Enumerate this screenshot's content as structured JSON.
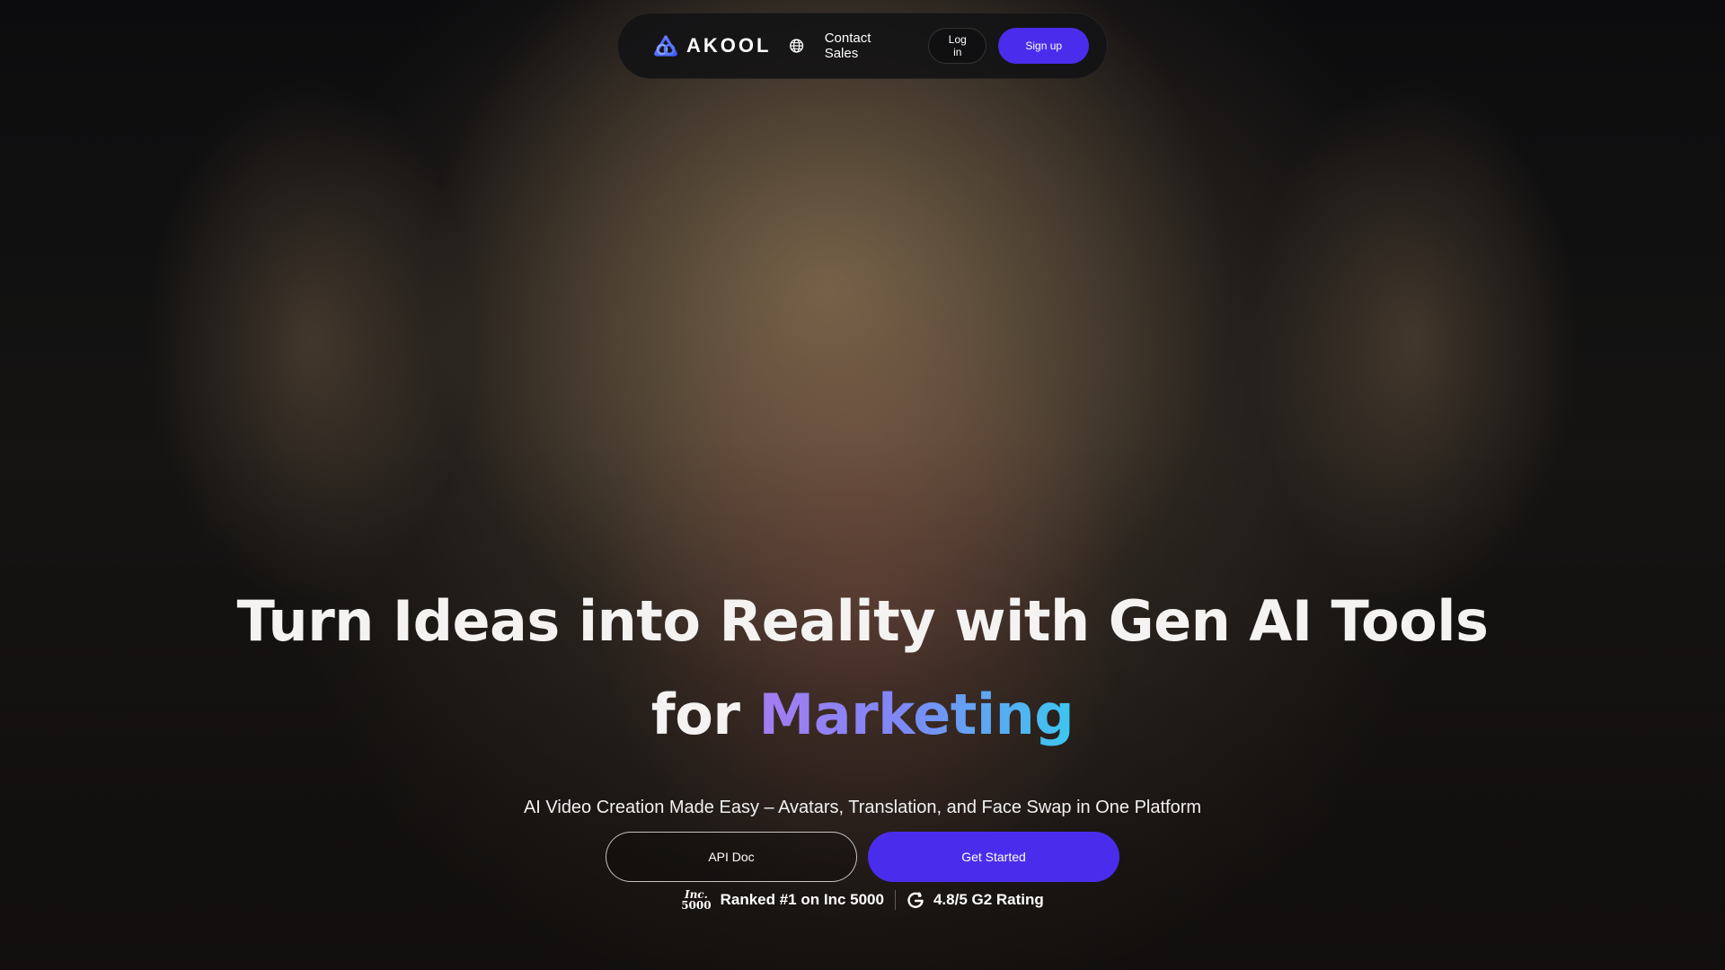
{
  "nav": {
    "brand": "AKOOL",
    "contact_sales": "Contact Sales",
    "login": "Log in",
    "signup": "Sign up"
  },
  "hero": {
    "headline_line1": "Turn Ideas into Reality with Gen AI Tools",
    "headline_line2_prefix": "for",
    "headline_line2_accent": "Marketing",
    "subtitle": "AI Video Creation Made Easy – Avatars, Translation, and Face Swap in One Platform",
    "api_doc": "API Doc",
    "get_started": "Get Started"
  },
  "badges": {
    "inc_logo_top": "Inc.",
    "inc_logo_bottom": "5000",
    "inc_text": "Ranked #1 on Inc 5000",
    "g2_text": "4.8/5 G2 Rating"
  },
  "colors": {
    "primary": "#4a2dec",
    "accent_gradient_start": "#a47cf2",
    "accent_gradient_end": "#3cc7f0"
  }
}
